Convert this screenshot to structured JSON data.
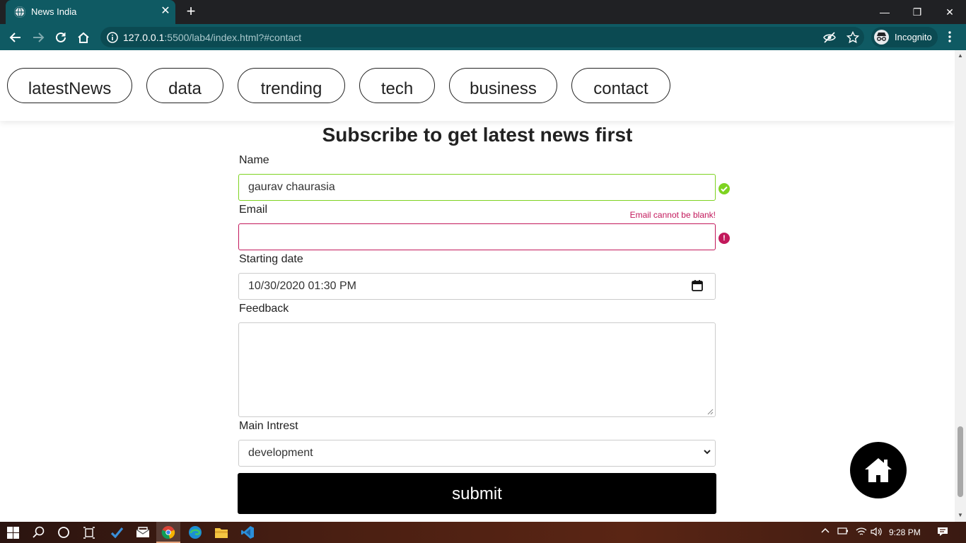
{
  "browser": {
    "tab_title": "News India",
    "tab_close": "✕",
    "new_tab": "+",
    "url_host": "127.0.0.1",
    "url_rest": ":5500/lab4/index.html?#contact",
    "profile_label": "Incognito",
    "window_min": "—",
    "window_max": "❐",
    "window_close": "✕"
  },
  "nav": {
    "items": [
      "latestNews",
      "data",
      "trending",
      "tech",
      "business",
      "contact"
    ]
  },
  "form": {
    "title": "Subscribe to get latest news first",
    "name_label": "Name",
    "name_value": "gaurav chaurasia",
    "email_label": "Email",
    "email_value": "",
    "email_error": "Email cannot be blank!",
    "date_label": "Starting date",
    "date_value": "10/30/2020  01:30  PM",
    "feedback_label": "Feedback",
    "interest_label": "Main Intrest",
    "interest_value": "development",
    "submit_label": "submit"
  },
  "colors": {
    "browser_accent": "#0f5a63",
    "valid": "#7ed321",
    "error": "#c2185b"
  },
  "taskbar": {
    "clock": "9:28 PM",
    "icons": [
      "windows-start-icon",
      "search-icon",
      "cortana-icon",
      "task-view-icon",
      "vscode-insiders-icon",
      "mail-icon",
      "chrome-icon",
      "edge-icon",
      "file-explorer-icon",
      "vscode-icon"
    ]
  }
}
